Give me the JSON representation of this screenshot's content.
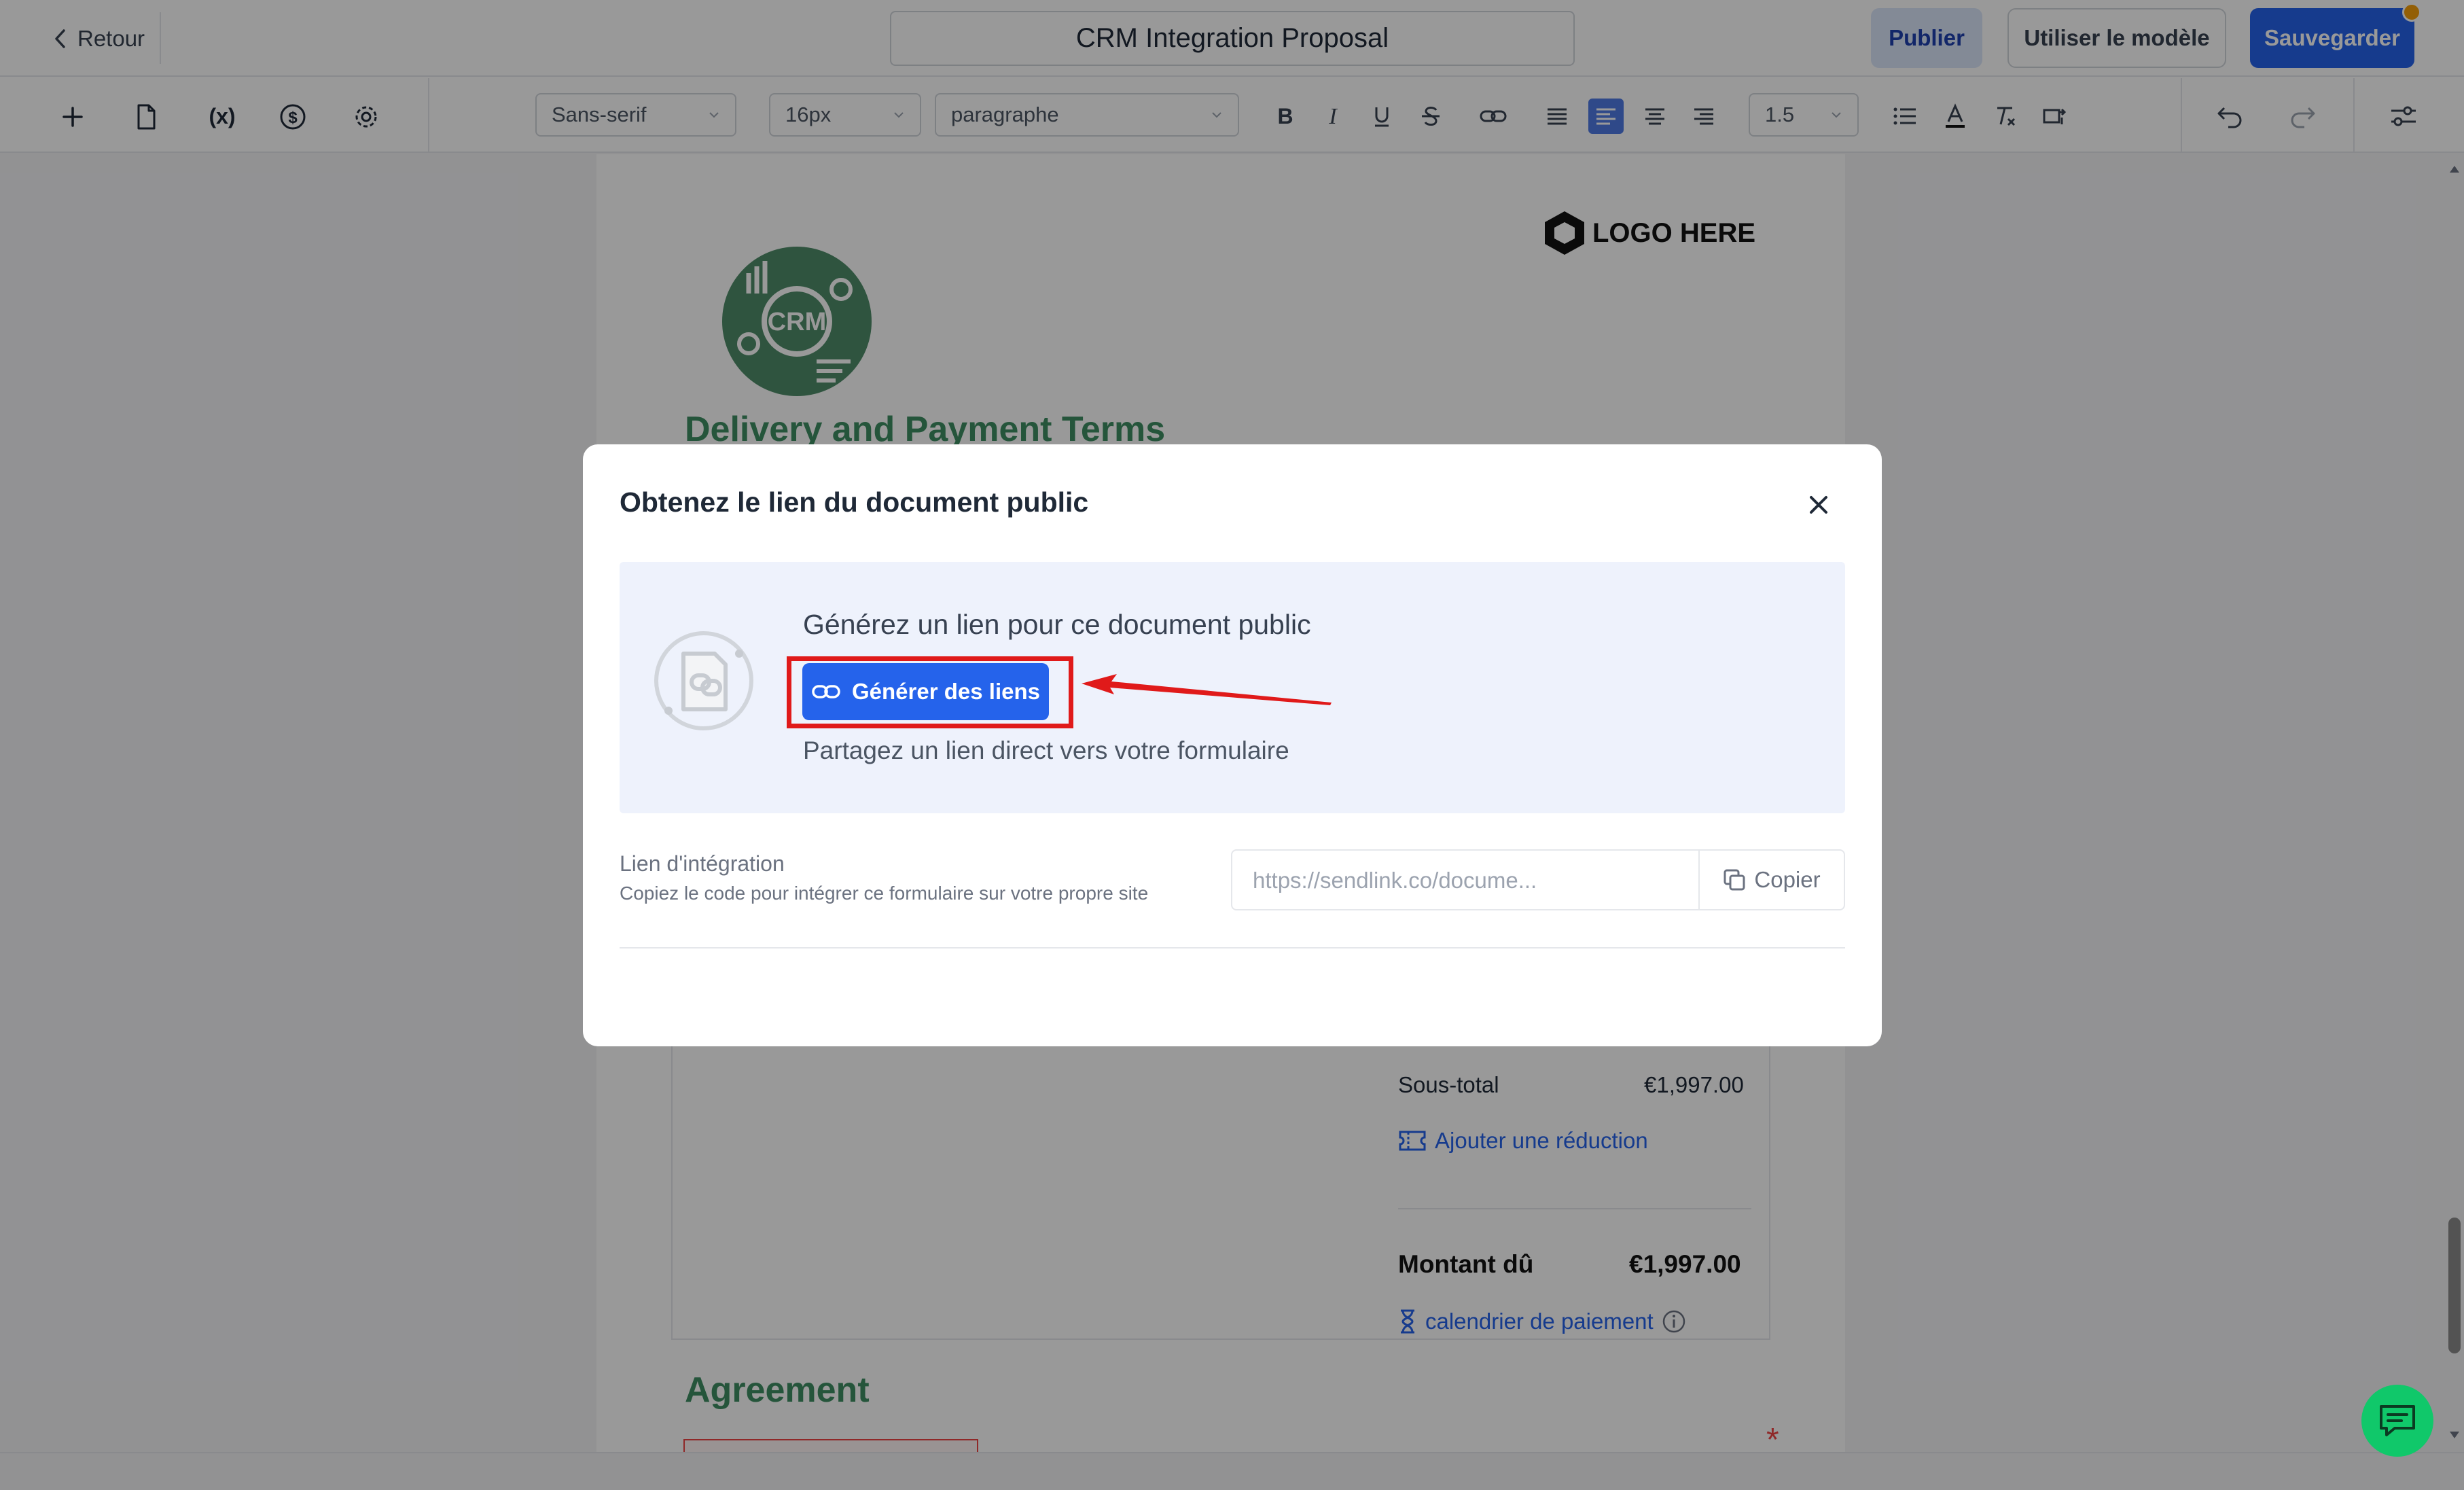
{
  "header": {
    "back_label": "Retour",
    "document_title": "CRM Integration Proposal",
    "publish_label": "Publier",
    "use_template_label": "Utiliser le modèle",
    "save_label": "Sauvegarder"
  },
  "toolbar": {
    "font_family": "Sans-serif",
    "font_size": "16px",
    "block_type": "paragraphe",
    "line_height": "1.5"
  },
  "document": {
    "logo_text": "LOGO HERE",
    "crm_badge_text": "CRM",
    "section_title": "Delivery and Payment Terms",
    "subtotal_label": "Sous-total",
    "subtotal_value": "€1,997.00",
    "discount_link": "Ajouter une réduction",
    "amount_due_label": "Montant dû",
    "amount_due_value": "€1,997.00",
    "payment_schedule_link": "calendrier de paiement",
    "agreement_title": "Agreement",
    "required_marker": "*"
  },
  "modal": {
    "title": "Obtenez le lien du document public",
    "generate_heading": "Générez un lien pour ce document public",
    "generate_button": "Générer des liens",
    "generate_subtext": "Partagez un lien direct vers votre formulaire",
    "embed_label": "Lien d'intégration",
    "embed_description": "Copiez le code pour intégrer ce formulaire sur votre propre site",
    "embed_placeholder": "https://sendlink.co/docume...",
    "copy_label": "Copier"
  },
  "colors": {
    "primary": "#2563eb",
    "section_green": "#3e8e63",
    "highlight_red": "#e01a1a",
    "chat_green": "#10c86a",
    "notification_orange": "#f59e0b"
  },
  "icons": {
    "toolbar_left": [
      "plus-icon",
      "document-icon",
      "variable-icon",
      "dollar-icon",
      "gear-icon"
    ],
    "format": [
      "bold-icon",
      "italic-icon",
      "underline-icon",
      "strikethrough-icon",
      "link-icon",
      "align-justify-icon",
      "align-left-icon",
      "align-center-icon",
      "align-right-icon",
      "bullet-list-icon",
      "text-color-icon",
      "clear-format-icon",
      "text-direction-icon"
    ],
    "history": [
      "undo-icon",
      "redo-icon"
    ],
    "settings": "sliders-icon",
    "chat": "chat-icon"
  }
}
